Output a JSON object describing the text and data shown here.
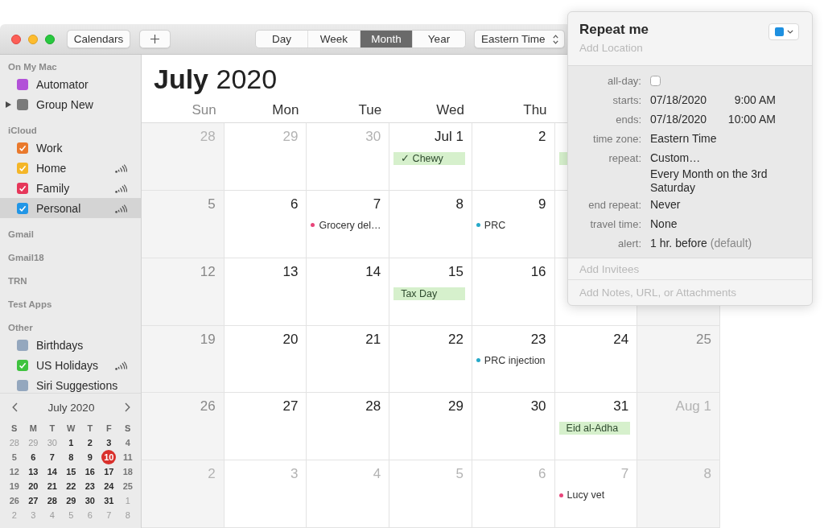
{
  "window": {
    "toolbar": {
      "calendars_button": "Calendars",
      "view_tabs": [
        {
          "label": "Day",
          "selected": false
        },
        {
          "label": "Week",
          "selected": false
        },
        {
          "label": "Month",
          "selected": true
        },
        {
          "label": "Year",
          "selected": false
        }
      ],
      "time_zone": "Eastern Time"
    },
    "sidebar": {
      "sections": [
        {
          "title": "On My Mac",
          "calendars": [
            {
              "kind": "calendar",
              "name": "Automator",
              "color": "#b251d8",
              "checked": false,
              "shared": false,
              "selected": false
            },
            {
              "kind": "group",
              "name": "Group New",
              "color": "#7b7b7b",
              "checked": false,
              "shared": false,
              "selected": false,
              "expanded": false
            }
          ]
        },
        {
          "title": "iCloud",
          "calendars": [
            {
              "kind": "calendar",
              "name": "Work",
              "color": "#e9792c",
              "checked": true,
              "shared": false,
              "selected": false
            },
            {
              "kind": "calendar",
              "name": "Home",
              "color": "#f4b628",
              "checked": true,
              "shared": true,
              "selected": false
            },
            {
              "kind": "calendar",
              "name": "Family",
              "color": "#e6375a",
              "checked": true,
              "shared": true,
              "selected": false
            },
            {
              "kind": "calendar",
              "name": "Personal",
              "color": "#2196e6",
              "checked": true,
              "shared": true,
              "selected": true
            }
          ]
        },
        {
          "title": "Gmail"
        },
        {
          "title": "Gmail18"
        },
        {
          "title": "TRN"
        },
        {
          "title": "Test Apps"
        },
        {
          "title": "Other",
          "calendars": [
            {
              "kind": "calendar",
              "name": "Birthdays",
              "color": "#94a7be",
              "checked": false,
              "shared": false,
              "selected": false
            },
            {
              "kind": "calendar",
              "name": "US Holidays",
              "color": "#3fc33f",
              "checked": true,
              "shared": true,
              "selected": false
            },
            {
              "kind": "calendar",
              "name": "Siri Suggestions",
              "color": "#94a7be",
              "checked": false,
              "shared": false,
              "selected": false
            }
          ]
        }
      ],
      "mini_calendar": {
        "month": "July 2020",
        "weekdays": [
          "S",
          "M",
          "T",
          "W",
          "T",
          "F",
          "S"
        ],
        "weeks": [
          [
            {
              "day": "28",
              "in_month": false,
              "today": false
            },
            {
              "day": "29",
              "in_month": false,
              "today": false
            },
            {
              "day": "30",
              "in_month": false,
              "today": false
            },
            {
              "day": "1",
              "in_month": true,
              "today": false
            },
            {
              "day": "2",
              "in_month": true,
              "today": false
            },
            {
              "day": "3",
              "in_month": true,
              "today": false
            },
            {
              "day": "4",
              "in_month": true,
              "today": false
            }
          ],
          [
            {
              "day": "5",
              "in_month": true,
              "today": false
            },
            {
              "day": "6",
              "in_month": true,
              "today": false
            },
            {
              "day": "7",
              "in_month": true,
              "today": false
            },
            {
              "day": "8",
              "in_month": true,
              "today": false
            },
            {
              "day": "9",
              "in_month": true,
              "today": false
            },
            {
              "day": "10",
              "in_month": true,
              "today": true
            },
            {
              "day": "11",
              "in_month": true,
              "today": false
            }
          ],
          [
            {
              "day": "12",
              "in_month": true,
              "today": false
            },
            {
              "day": "13",
              "in_month": true,
              "today": false
            },
            {
              "day": "14",
              "in_month": true,
              "today": false
            },
            {
              "day": "15",
              "in_month": true,
              "today": false
            },
            {
              "day": "16",
              "in_month": true,
              "today": false
            },
            {
              "day": "17",
              "in_month": true,
              "today": false
            },
            {
              "day": "18",
              "in_month": true,
              "today": false
            }
          ],
          [
            {
              "day": "19",
              "in_month": true,
              "today": false
            },
            {
              "day": "20",
              "in_month": true,
              "today": false
            },
            {
              "day": "21",
              "in_month": true,
              "today": false
            },
            {
              "day": "22",
              "in_month": true,
              "today": false
            },
            {
              "day": "23",
              "in_month": true,
              "today": false
            },
            {
              "day": "24",
              "in_month": true,
              "today": false
            },
            {
              "day": "25",
              "in_month": true,
              "today": false
            }
          ],
          [
            {
              "day": "26",
              "in_month": true,
              "today": false
            },
            {
              "day": "27",
              "in_month": true,
              "today": false
            },
            {
              "day": "28",
              "in_month": true,
              "today": false
            },
            {
              "day": "29",
              "in_month": true,
              "today": false
            },
            {
              "day": "30",
              "in_month": true,
              "today": false
            },
            {
              "day": "31",
              "in_month": true,
              "today": false
            },
            {
              "day": "1",
              "in_month": false,
              "today": false
            }
          ],
          [
            {
              "day": "2",
              "in_month": false,
              "today": false
            },
            {
              "day": "3",
              "in_month": false,
              "today": false
            },
            {
              "day": "4",
              "in_month": false,
              "today": false
            },
            {
              "day": "5",
              "in_month": false,
              "today": false
            },
            {
              "day": "6",
              "in_month": false,
              "today": false
            },
            {
              "day": "7",
              "in_month": false,
              "today": false
            },
            {
              "day": "8",
              "in_month": false,
              "today": false
            }
          ]
        ]
      }
    },
    "month_view": {
      "title": "**July** 2020",
      "weekdays": [
        "Sun",
        "Mon",
        "Tue",
        "Wed",
        "Thu"
      ],
      "weeks": [
        [
          {
            "date": "28",
            "in_month": false
          },
          {
            "date": "29",
            "in_month": false
          },
          {
            "date": "30",
            "in_month": false
          },
          {
            "date": "Jul 1",
            "in_month": true,
            "events": [
              {
                "kind": "all-day",
                "title": "✓ Chewy"
              }
            ]
          },
          {
            "date": "2",
            "in_month": true
          },
          {
            "events": [
              {
                "kind": "all-day"
              }
            ]
          }
        ],
        [
          {
            "date": "5",
            "in_month": true
          },
          {
            "date": "6",
            "in_month": true
          },
          {
            "date": "7",
            "in_month": true,
            "events": [
              {
                "kind": "timed",
                "title": "Grocery del…",
                "color": "#e8457a"
              }
            ]
          },
          {
            "date": "8",
            "in_month": true
          },
          {
            "date": "9",
            "in_month": true,
            "events": [
              {
                "kind": "timed",
                "title": "PRC",
                "color": "#26a9c9"
              }
            ]
          }
        ],
        [
          {
            "date": "12",
            "in_month": true
          },
          {
            "date": "13",
            "in_month": true
          },
          {
            "date": "14",
            "in_month": true
          },
          {
            "date": "15",
            "in_month": true,
            "events": [
              {
                "kind": "all-day",
                "title": "Tax Day"
              }
            ]
          },
          {
            "date": "16",
            "in_month": true
          }
        ],
        [
          {
            "date": "19",
            "in_month": true
          },
          {
            "date": "20",
            "in_month": true
          },
          {
            "date": "21",
            "in_month": true
          },
          {
            "date": "22",
            "in_month": true
          },
          {
            "date": "23",
            "in_month": true,
            "events": [
              {
                "kind": "timed",
                "title": "PRC injection",
                "color": "#26a9c9"
              }
            ]
          },
          {
            "date": "24",
            "in_month": true
          },
          {
            "date": "25",
            "in_month": true
          }
        ],
        [
          {
            "date": "26",
            "in_month": true
          },
          {
            "date": "27",
            "in_month": true
          },
          {
            "date": "28",
            "in_month": true
          },
          {
            "date": "29",
            "in_month": true
          },
          {
            "date": "30",
            "in_month": true
          },
          {
            "date": "31",
            "in_month": true,
            "events": [
              {
                "kind": "all-day",
                "title": "Eid al-Adha"
              }
            ]
          },
          {
            "date": "Aug 1",
            "in_month": false
          }
        ],
        [
          {
            "date": "2",
            "in_month": false
          },
          {
            "date": "3",
            "in_month": false
          },
          {
            "date": "4",
            "in_month": false
          },
          {
            "date": "5",
            "in_month": false
          },
          {
            "date": "6",
            "in_month": false
          },
          {
            "date": "7",
            "in_month": false,
            "events": [
              {
                "kind": "timed",
                "title": "Lucy vet",
                "color": "#e8457a"
              }
            ]
          },
          {
            "date": "8",
            "in_month": false
          }
        ]
      ]
    }
  },
  "event_popover": {
    "title": "Repeat me",
    "location_placeholder": "Add Location",
    "color": "#1e90e0",
    "fields": [
      {
        "kind": "checkbox",
        "label": "all-day:",
        "checked": false
      },
      {
        "kind": "datetime",
        "label": "starts:",
        "date": "07/18/2020",
        "time": "9:00 AM"
      },
      {
        "kind": "datetime",
        "label": "ends:",
        "date": "07/18/2020",
        "time": "10:00 AM"
      },
      {
        "kind": "text",
        "label": "time zone:",
        "value": "Eastern Time"
      },
      {
        "kind": "text",
        "label": "repeat:",
        "value": "Custom…"
      },
      {
        "kind": "text",
        "value": "Every Month on the 3rd Saturday"
      },
      {
        "kind": "text",
        "label": "end repeat:",
        "value": "Never"
      },
      {
        "kind": "text",
        "label": "travel time:",
        "value": "None"
      },
      {
        "kind": "text",
        "label": "alert:",
        "value": "1 hr. before",
        "note": "(default)"
      }
    ],
    "invitees_placeholder": "Add Invitees",
    "notes_placeholder": "Add Notes, URL, or Attachments"
  }
}
